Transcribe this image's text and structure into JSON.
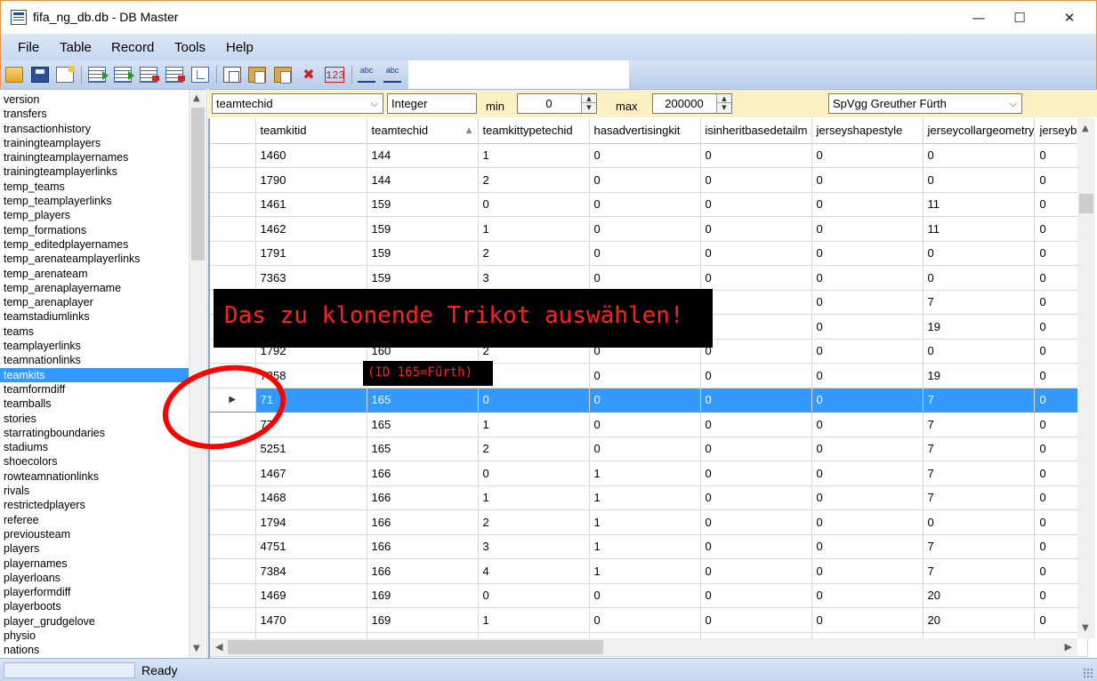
{
  "window": {
    "title": "fifa_ng_db.db - DB Master",
    "min_glyph": "—",
    "max_glyph": "☐",
    "close_glyph": "✕"
  },
  "menu": [
    "File",
    "Table",
    "Record",
    "Tools",
    "Help"
  ],
  "toolbar": {
    "icons": [
      "open-folder-icon",
      "save-icon",
      "new-icon",
      "goto-row-icon",
      "next-row-icon",
      "delete-row-icon",
      "remove-row-icon",
      "tree-icon",
      "copy-icon",
      "paste-special-icon",
      "paste-icon",
      "delete-icon",
      "number-format-icon",
      "spellcheck-icon",
      "spellcheck-alt-icon"
    ],
    "delete_glyph": "✖",
    "numfmt_label": "123",
    "spell_label": "abc",
    "spell2_label": "abc"
  },
  "tables": [
    "version",
    "transfers",
    "transactionhistory",
    "trainingteamplayers",
    "trainingteamplayernames",
    "trainingteamplayerlinks",
    "temp_teams",
    "temp_teamplayerlinks",
    "temp_players",
    "temp_formations",
    "temp_editedplayernames",
    "temp_arenateamplayerlinks",
    "temp_arenateam",
    "temp_arenaplayername",
    "temp_arenaplayer",
    "teamstadiumlinks",
    "teams",
    "teamplayerlinks",
    "teamnationlinks",
    "teamkits",
    "teamformdiff",
    "teamballs",
    "stories",
    "starratingboundaries",
    "stadiums",
    "shoecolors",
    "rowteamnationlinks",
    "rivals",
    "restrictedplayers",
    "referee",
    "previousteam",
    "players",
    "playernames",
    "playerloans",
    "playerformdiff",
    "playerboots",
    "player_grudgelove",
    "physio",
    "nations"
  ],
  "selected_table": "teamkits",
  "filter": {
    "field": "teamtechid",
    "type": "Integer",
    "min_label": "min",
    "min_value": "0",
    "max_label": "max",
    "max_value": "200000",
    "team": "SpVgg Greuther Fürth",
    "arrow": "⌵"
  },
  "grid": {
    "columns": [
      "teamkitid",
      "teamtechid",
      "teamkittypetechid",
      "hasadvertisingkit",
      "isinheritbasedetailm",
      "jerseyshapestyle",
      "jerseycollargeometry",
      "jerseyb"
    ],
    "sorted_column": "teamtechid",
    "selected_row_index": 10,
    "row_marker": "▶",
    "rows": [
      [
        "1460",
        "144",
        "1",
        "0",
        "0",
        "0",
        "0",
        "0"
      ],
      [
        "1790",
        "144",
        "2",
        "0",
        "0",
        "0",
        "0",
        "0"
      ],
      [
        "1461",
        "159",
        "0",
        "0",
        "0",
        "0",
        "11",
        "0"
      ],
      [
        "1462",
        "159",
        "1",
        "0",
        "0",
        "0",
        "11",
        "0"
      ],
      [
        "1791",
        "159",
        "2",
        "0",
        "0",
        "0",
        "0",
        "0"
      ],
      [
        "7363",
        "159",
        "3",
        "0",
        "0",
        "0",
        "0",
        "0"
      ],
      [
        "",
        "",
        "",
        "",
        "",
        "0",
        "7",
        "0"
      ],
      [
        "",
        "",
        "",
        "",
        "",
        "0",
        "19",
        "0"
      ],
      [
        "1792",
        "160",
        "2",
        "0",
        "0",
        "0",
        "0",
        "0"
      ],
      [
        "7358",
        "",
        "",
        "0",
        "0",
        "0",
        "19",
        "0"
      ],
      [
        "71",
        "165",
        "0",
        "0",
        "0",
        "0",
        "7",
        "0"
      ],
      [
        "77",
        "165",
        "1",
        "0",
        "0",
        "0",
        "7",
        "0"
      ],
      [
        "5251",
        "165",
        "2",
        "0",
        "0",
        "0",
        "7",
        "0"
      ],
      [
        "1467",
        "166",
        "0",
        "1",
        "0",
        "0",
        "7",
        "0"
      ],
      [
        "1468",
        "166",
        "1",
        "1",
        "0",
        "0",
        "7",
        "0"
      ],
      [
        "1794",
        "166",
        "2",
        "1",
        "0",
        "0",
        "0",
        "0"
      ],
      [
        "4751",
        "166",
        "3",
        "1",
        "0",
        "0",
        "7",
        "0"
      ],
      [
        "7384",
        "166",
        "4",
        "1",
        "0",
        "0",
        "7",
        "0"
      ],
      [
        "1469",
        "169",
        "0",
        "0",
        "0",
        "0",
        "20",
        "0"
      ],
      [
        "1470",
        "169",
        "1",
        "0",
        "0",
        "0",
        "20",
        "0"
      ],
      [
        "",
        "",
        "",
        "",
        "",
        "",
        "",
        ""
      ]
    ]
  },
  "annotation": {
    "main": "Das zu klonende Trikot auswählen!",
    "sub": "(ID 165=Fürth)"
  },
  "status": {
    "text": "Ready"
  },
  "colors": {
    "selection": "#3399ff",
    "annotation_text": "#ff2020",
    "filter_bar": "#fbf0c2"
  }
}
